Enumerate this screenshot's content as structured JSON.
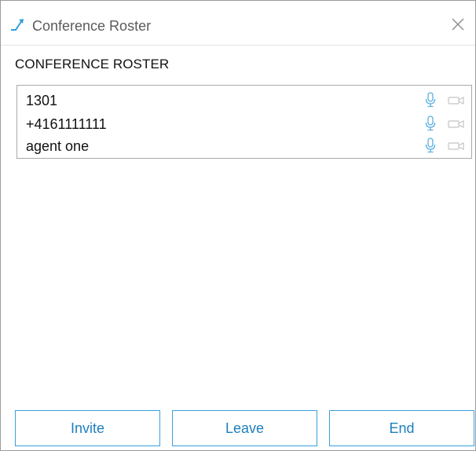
{
  "window": {
    "title": "Conference Roster",
    "close_icon": "close-icon",
    "app_icon": "call-transfer-icon"
  },
  "roster": {
    "heading": "CONFERENCE ROSTER",
    "participants": [
      {
        "name": "1301",
        "mic_icon": "microphone-icon",
        "camera_icon": "video-camera-icon"
      },
      {
        "name": "+4161111111",
        "mic_icon": "microphone-icon",
        "camera_icon": "video-camera-icon"
      },
      {
        "name": "agent one",
        "mic_icon": "microphone-icon",
        "camera_icon": "video-camera-icon"
      }
    ]
  },
  "actions": {
    "invite_label": "Invite",
    "leave_label": "Leave",
    "end_label": "End"
  },
  "colors": {
    "accent": "#1d7fbf",
    "button_border": "#3aa0dc",
    "icon_blue": "#5ab0e0",
    "icon_grey": "#c4c4c4"
  }
}
